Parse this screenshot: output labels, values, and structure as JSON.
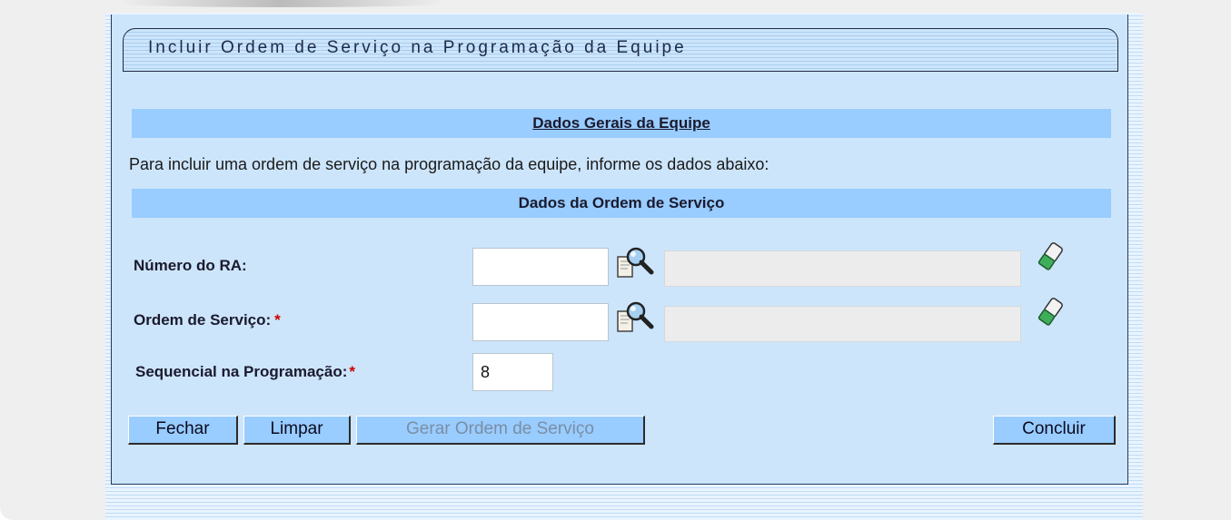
{
  "form": {
    "title": "Incluir Ordem de Serviço na Programação da Equipe",
    "section_general": "Dados Gerais da Equipe",
    "instruction": "Para incluir uma ordem de serviço na programação da equipe, informe os dados abaixo:",
    "section_order": "Dados da Ordem de Serviço"
  },
  "fields": {
    "numero_ra": {
      "label": "Número do RA:",
      "value": "",
      "description": ""
    },
    "ordem_servico": {
      "label": "Ordem de Serviço:",
      "required_mark": "*",
      "value": "",
      "description": ""
    },
    "sequencial": {
      "label": "Sequencial na Programação:",
      "required_mark": "*",
      "value": "8"
    }
  },
  "buttons": {
    "fechar": "Fechar",
    "limpar": "Limpar",
    "gerar": "Gerar Ordem de Serviço",
    "concluir": "Concluir"
  },
  "icons": {
    "search": "magnifier-search-icon",
    "clear": "eraser-icon"
  },
  "colors": {
    "panel_bg": "#cde5fb",
    "section_bar": "#99ccff",
    "required": "#cc0000",
    "button_bg": "#99ccff"
  }
}
